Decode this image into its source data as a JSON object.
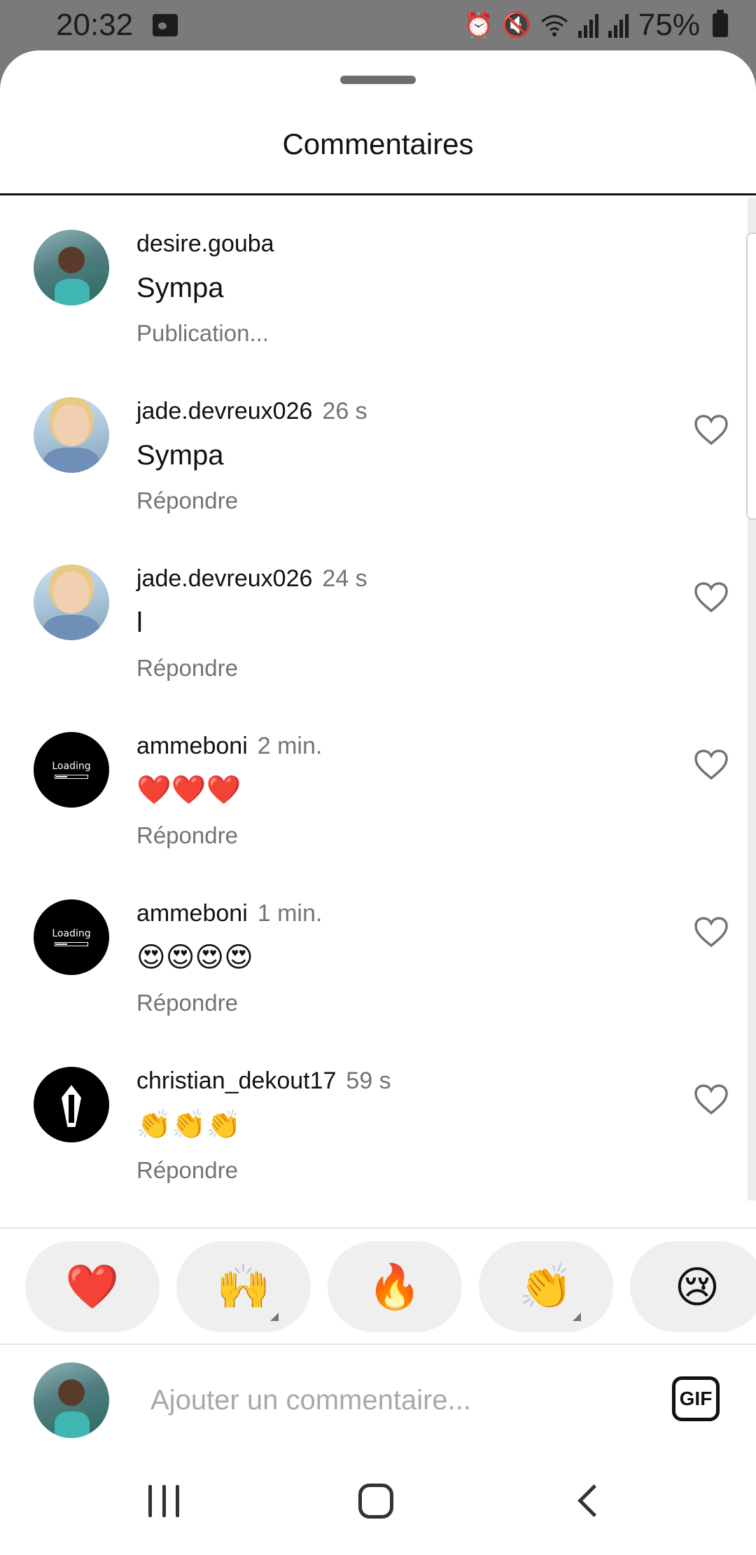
{
  "status_bar": {
    "time": "20:32",
    "battery": "75%"
  },
  "sheet": {
    "title": "Commentaires"
  },
  "comments": [
    {
      "user": "desire.gouba",
      "time": "",
      "text": "Sympa",
      "action": "Publication...",
      "avatar": "photo-male"
    },
    {
      "user": "jade.devreux026",
      "time": "26 s",
      "text": "Sympa",
      "action": "Répondre",
      "avatar": "photo-female"
    },
    {
      "user": "jade.devreux026",
      "time": "24 s",
      "text": "l",
      "action": "Répondre",
      "avatar": "photo-female"
    },
    {
      "user": "ammeboni",
      "time": "2 min.",
      "text": "❤️❤️❤️",
      "action": "Répondre",
      "avatar": "loading"
    },
    {
      "user": "ammeboni",
      "time": "1 min.",
      "text": "😍😍😍😍",
      "action": "Répondre",
      "avatar": "loading"
    },
    {
      "user": "christian_dekout17",
      "time": "59 s",
      "text": "👏👏👏",
      "action": "Répondre",
      "avatar": "suit"
    }
  ],
  "avatar_loading_text": "Loading",
  "quick_reactions": [
    "❤️",
    "🙌",
    "🔥",
    "👏",
    "😢"
  ],
  "input": {
    "placeholder": "Ajouter un commentaire...",
    "gif_label": "GIF"
  },
  "colors": {
    "heart_red": "#ed1c24",
    "secondary_text": "#737373"
  }
}
